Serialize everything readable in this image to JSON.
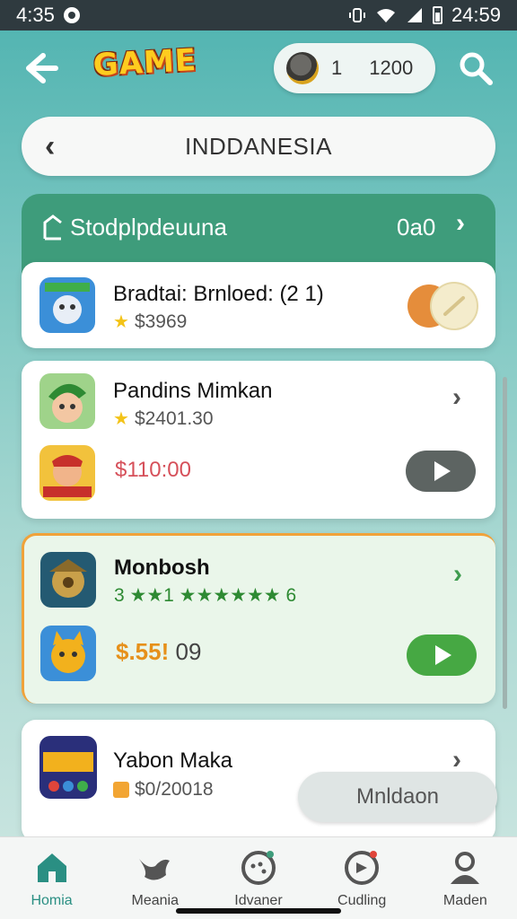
{
  "status": {
    "time": "4:35",
    "clock": "24:59"
  },
  "header": {
    "logo": "GAME",
    "coins_a": "1",
    "coins_b": "1200"
  },
  "region": {
    "title": "INDDANESIA"
  },
  "section": {
    "title": "Stodplpdeuuna",
    "count": "0a0"
  },
  "cards": [
    {
      "title": "Bradtai: Brnloed: (2 1)",
      "sub": "$3969"
    },
    {
      "title": "Pandins Mimkan",
      "sub": "$2401.30",
      "price": "$110:00"
    },
    {
      "title": "Monbosh",
      "rating": "3 ★★1 ★★★★★★ 6",
      "price_hl": "$.55!",
      "price_rest": " 09"
    },
    {
      "title": "Yabon Maka",
      "sub": "$0/20018",
      "pill": "Mnldaon"
    }
  ],
  "nav": [
    {
      "label": "Homia",
      "icon": "home-icon"
    },
    {
      "label": "Meania",
      "icon": "bird-icon"
    },
    {
      "label": "Idvaner",
      "icon": "chat-bubble-icon"
    },
    {
      "label": "Cudling",
      "icon": "speech-icon"
    },
    {
      "label": "Maden",
      "icon": "person-icon"
    }
  ],
  "colors": {
    "accent": "#3e9c7b",
    "play_green": "#46a843",
    "play_gray": "#5d6462",
    "price_red": "#d6505a",
    "price_orange": "#e6901a"
  }
}
